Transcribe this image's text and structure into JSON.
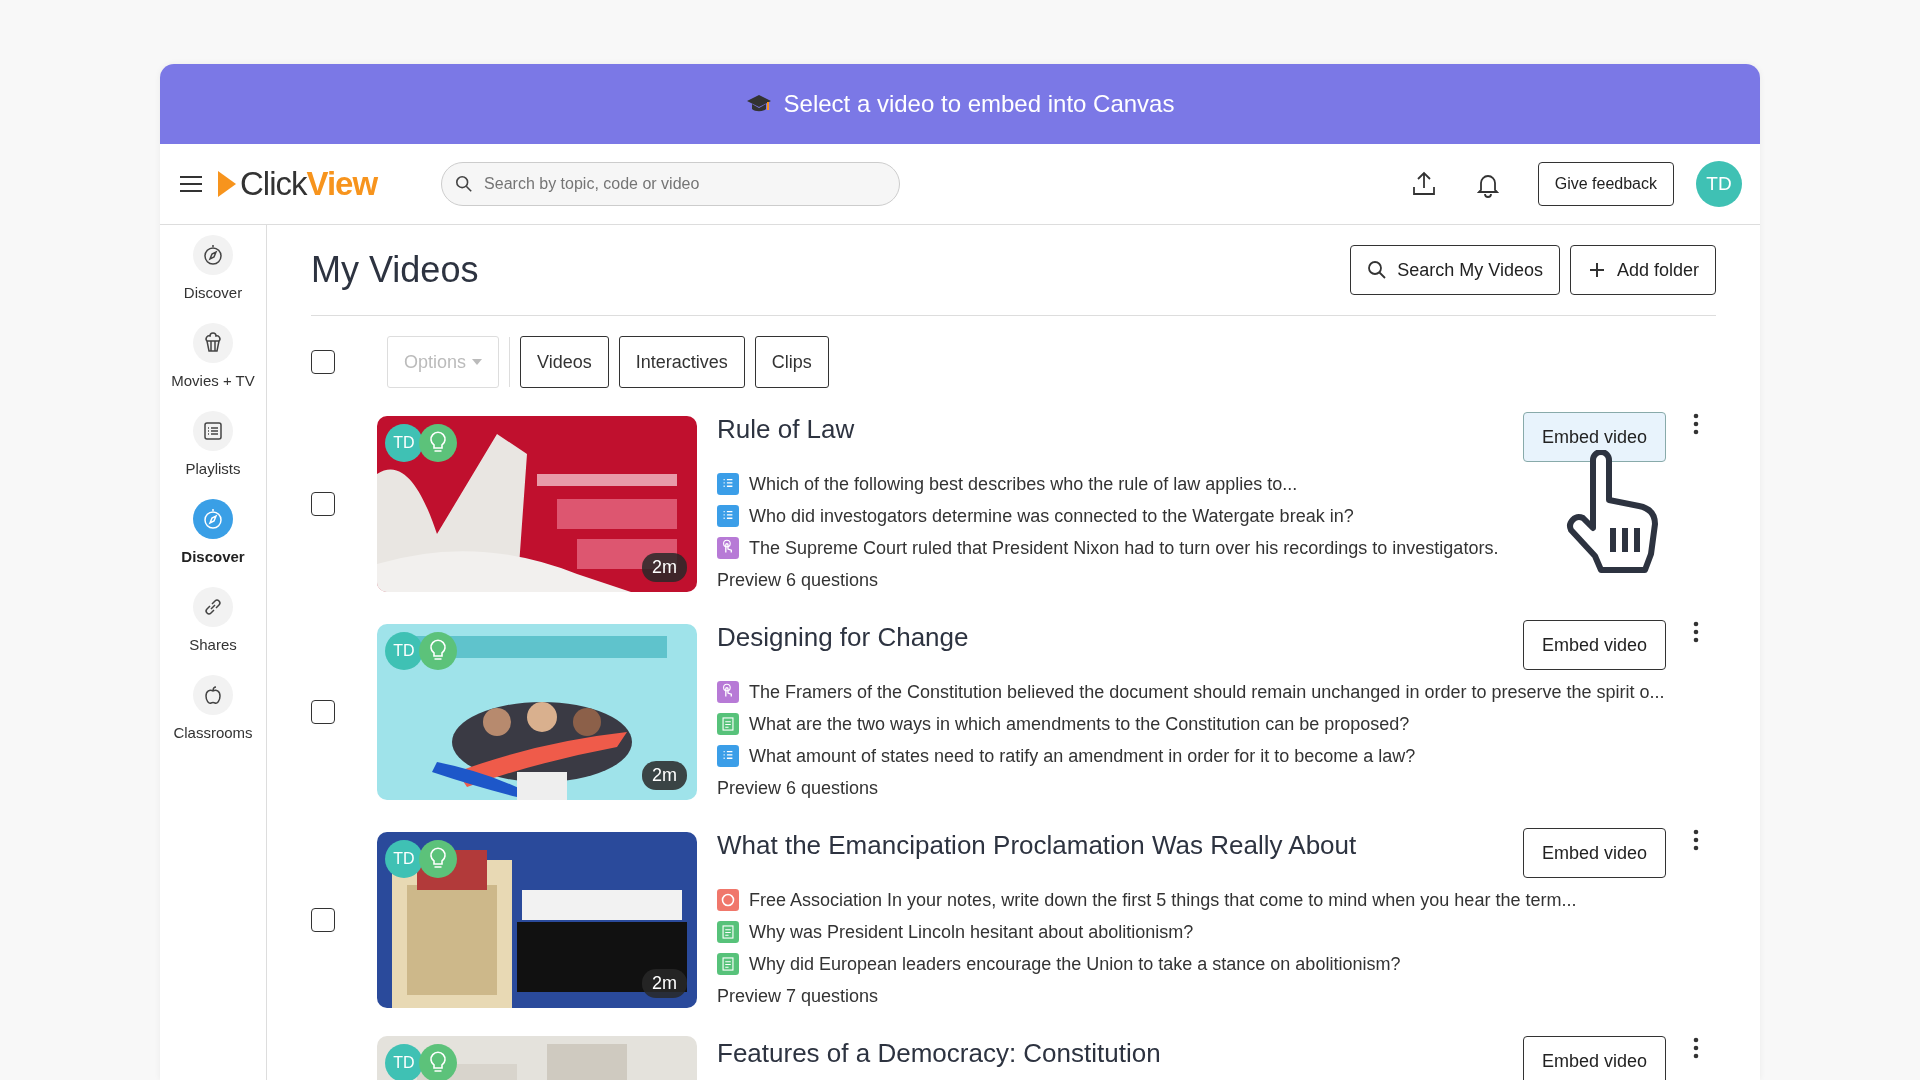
{
  "banner": {
    "text": "Select a video to embed into Canvas"
  },
  "header": {
    "logo_left": "Click",
    "logo_right": "View",
    "search": {
      "placeholder": "Search by topic, code or video"
    },
    "feedback_button": "Give feedback",
    "avatar": "TD"
  },
  "sidebar": {
    "items": [
      {
        "label": "Discover",
        "kind": "compass",
        "selected": false
      },
      {
        "label": "Movies + TV",
        "kind": "popcorn",
        "selected": false
      },
      {
        "label": "Playlists",
        "kind": "list",
        "selected": false
      },
      {
        "label": "Discover",
        "kind": "compass",
        "selected": true
      },
      {
        "label": "Shares",
        "kind": "link",
        "selected": false
      },
      {
        "label": "Classrooms",
        "kind": "apple",
        "selected": false
      }
    ]
  },
  "page": {
    "title": "My Videos",
    "search_button": "Search My Videos",
    "add_folder_button": "Add folder"
  },
  "toolbar": {
    "select_all_checked": false,
    "options": {
      "label": "Options",
      "disabled": true
    },
    "filters": [
      "Videos",
      "Interactives",
      "Clips"
    ]
  },
  "videos": [
    {
      "checked": false,
      "owner": "TD",
      "duration": "2m",
      "title": "Rule of Law",
      "embed_label": "Embed video",
      "hovered": true,
      "questions": [
        {
          "kind": "list",
          "text": "Which of the following best describes who the rule of law applies to..."
        },
        {
          "kind": "list",
          "text": "Who did investogators determine was connected to the Watergate break in?"
        },
        {
          "kind": "touch",
          "text": "The Supreme Court ruled that President Nixon had to turn over his recordings to investigators."
        }
      ],
      "preview": "Preview 6 questions"
    },
    {
      "checked": false,
      "owner": "TD",
      "duration": "2m",
      "title": "Designing for Change",
      "embed_label": "Embed video",
      "hovered": false,
      "questions": [
        {
          "kind": "touch",
          "text": "The Framers of the Constitution believed the document should remain unchanged in order to preserve the spirit o..."
        },
        {
          "kind": "doc",
          "text": "What are the two ways in which amendments to the Constitution can be proposed?"
        },
        {
          "kind": "list",
          "text": "What amount of states need to ratify an amendment in order for it to become a law?"
        }
      ],
      "preview": "Preview 6 questions"
    },
    {
      "checked": false,
      "owner": "TD",
      "duration": "2m",
      "title": "What the Emancipation Proclamation Was Really About",
      "embed_label": "Embed video",
      "hovered": false,
      "questions": [
        {
          "kind": "chat",
          "text": "Free Association In your notes, write down the first 5 things that come to mind when you hear the term..."
        },
        {
          "kind": "doc",
          "text": "Why was President Lincoln hesitant about abolitionism?"
        },
        {
          "kind": "doc",
          "text": "Why did European leaders encourage the Union to take a stance on abolitionism?"
        }
      ],
      "preview": "Preview 7 questions"
    },
    {
      "owner": "TD",
      "title": "Features of a Democracy: Constitution",
      "embed_label": "Embed video",
      "hovered": false
    }
  ]
}
